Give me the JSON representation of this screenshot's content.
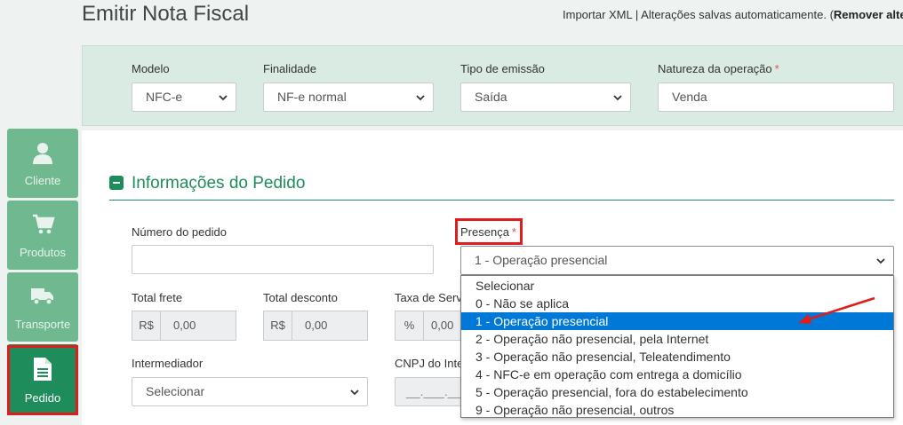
{
  "page": {
    "title": "Emitir Nota Fiscal",
    "import_xml": "Importar XML",
    "separator": " | Alterações salvas automaticamente. (",
    "remove_changes": "Remover alter"
  },
  "header": {
    "modelo": {
      "label": "Modelo",
      "value": "NFC-e"
    },
    "finalidade": {
      "label": "Finalidade",
      "value": "NF-e normal"
    },
    "tipo_emissao": {
      "label": "Tipo de emissão",
      "value": "Saída"
    },
    "natureza": {
      "label": "Natureza da operação",
      "required_mark": "*",
      "value": "Venda"
    }
  },
  "sidebar": {
    "items": [
      {
        "label": "Cliente",
        "icon": "user-icon"
      },
      {
        "label": "Produtos",
        "icon": "cart-icon"
      },
      {
        "label": "Transporte",
        "icon": "truck-icon"
      },
      {
        "label": "Pedido",
        "icon": "document-icon",
        "active": true
      }
    ]
  },
  "section": {
    "title": "Informações do Pedido",
    "numero_pedido": {
      "label": "Número do pedido",
      "value": ""
    },
    "presenca": {
      "label": "Presença",
      "required_mark": "*",
      "value": "1 - Operação presencial"
    },
    "total_frete": {
      "label": "Total frete",
      "prefix": "R$",
      "value": "0,00"
    },
    "total_desconto": {
      "label": "Total desconto",
      "prefix": "R$",
      "value": "0,00"
    },
    "taxa_servico": {
      "label": "Taxa de Servi",
      "prefix": "%",
      "value": "0,00"
    },
    "intermediador": {
      "label": "Intermediador",
      "value": "Selecionar"
    },
    "cnpj_intermediador": {
      "label": "CNPJ do Inte",
      "placeholder": "__.___.___/"
    }
  },
  "presenca_options": [
    "Selecionar",
    "0 - Não se aplica",
    "1 - Operação presencial",
    "2 - Operação não presencial, pela Internet",
    "3 - Operação não presencial, Teleatendimento",
    "4 - NFC-e em operação com entrega a domicílio",
    "5 - Operação presencial, fora do estabelecimento",
    "9 - Operação não presencial, outros"
  ],
  "presenca_selected_index": 2,
  "colors": {
    "brand_green": "#1f8c5b",
    "sidebar_green": "#6fb890",
    "highlight_red": "#e01c1c",
    "selection_blue": "#0078d7"
  }
}
